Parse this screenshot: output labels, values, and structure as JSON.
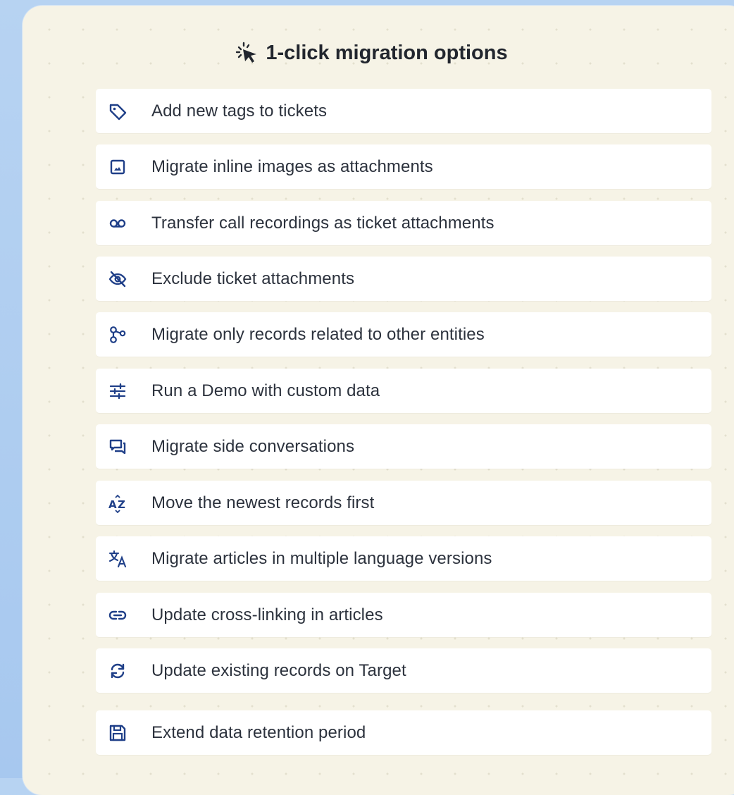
{
  "title": "1-click migration options",
  "accent_color": "#1f3f88",
  "options": [
    {
      "icon": "tag-icon",
      "label": "Add new tags to tickets"
    },
    {
      "icon": "image-icon",
      "label": "Migrate inline images as attachments"
    },
    {
      "icon": "voicemail-icon",
      "label": "Transfer call recordings as ticket attachments"
    },
    {
      "icon": "eye-off-icon",
      "label": "Exclude ticket attachments"
    },
    {
      "icon": "relations-icon",
      "label": "Migrate only records related to other entities"
    },
    {
      "icon": "sliders-icon",
      "label": "Run a Demo with custom data"
    },
    {
      "icon": "chat-icon",
      "label": "Migrate side conversations"
    },
    {
      "icon": "sort-az-icon",
      "label": "Move the newest records first"
    },
    {
      "icon": "translate-icon",
      "label": "Migrate articles in multiple language versions"
    },
    {
      "icon": "link-icon",
      "label": "Update cross-linking in articles"
    },
    {
      "icon": "refresh-icon",
      "label": "Update existing records on Target"
    },
    {
      "icon": "save-icon",
      "label": "Extend data retention period"
    }
  ]
}
